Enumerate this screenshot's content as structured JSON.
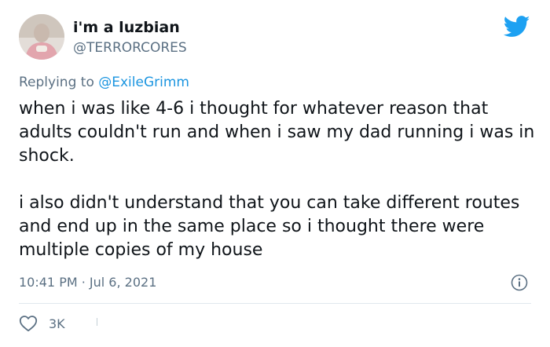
{
  "author": {
    "display_name": "i'm a luzbian",
    "handle": "@TERRORCORES",
    "avatar_icon": "avatar-image"
  },
  "reply": {
    "prefix": "Replying to ",
    "to": "@ExileGrimm"
  },
  "tweet": {
    "paragraphs": [
      "when i was like 4-6 i thought for whatever reason that adults couldn't run and when i saw my dad running i was in shock.",
      "i also didn't understand that you can take different routes and end up in the same place so i thought there were multiple copies of my house"
    ],
    "timestamp": "10:41 PM · Jul 6, 2021"
  },
  "actions": {
    "like_count": "3K",
    "like_icon": "heart-icon",
    "info_icon": "info-icon"
  },
  "brand": {
    "icon": "twitter-bird-icon",
    "color": "#1da1f2"
  }
}
